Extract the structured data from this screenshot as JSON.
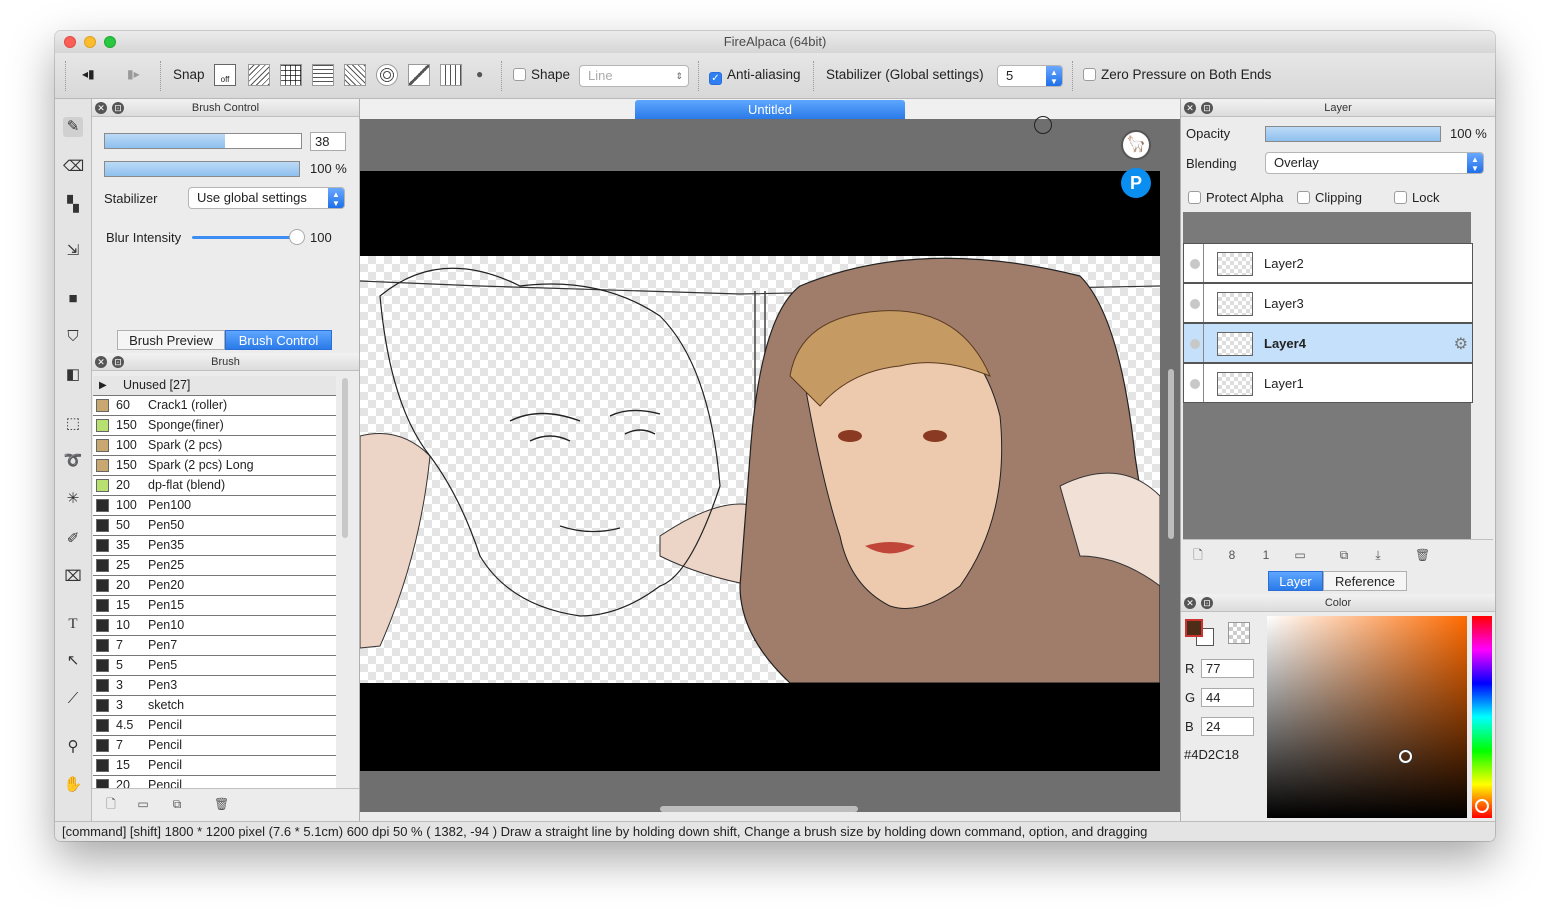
{
  "window": {
    "title": "FireAlpaca (64bit)"
  },
  "toolbar": {
    "snap_label": "Snap",
    "snap_off_label": "off",
    "shape_label": "Shape",
    "shape_value": "Line",
    "antialias_label": "Anti-aliasing",
    "stabilizer_label": "Stabilizer (Global settings)",
    "stabilizer_value": "5",
    "zero_pressure_label": "Zero Pressure on Both Ends"
  },
  "brush_control": {
    "title": "Brush Control",
    "size_value": "38",
    "size_fill": 0.61,
    "opacity_value": "100 %",
    "opacity_fill": 1.0,
    "stabilizer_label": "Stabilizer",
    "stabilizer_value": "Use global settings",
    "blur_label": "Blur Intensity",
    "blur_value": "100",
    "blur_fill": 1.0,
    "tabs": [
      "Brush Preview",
      "Brush Control"
    ]
  },
  "brush_panel": {
    "title": "Brush",
    "group_label": "Unused [27]",
    "items": [
      {
        "size": "60",
        "name": "Crack1 (roller)",
        "color": "#c8a870"
      },
      {
        "size": "150",
        "name": "Sponge(finer)",
        "color": "#b8e070"
      },
      {
        "size": "100",
        "name": "Spark (2 pcs)",
        "color": "#c8a870"
      },
      {
        "size": "150",
        "name": "Spark (2 pcs) Long",
        "color": "#c8a870"
      },
      {
        "size": "20",
        "name": "dp-flat (blend)",
        "color": "#b8e070"
      },
      {
        "size": "100",
        "name": "Pen100",
        "color": "#2a2a2a"
      },
      {
        "size": "50",
        "name": "Pen50",
        "color": "#2a2a2a"
      },
      {
        "size": "35",
        "name": "Pen35",
        "color": "#2a2a2a"
      },
      {
        "size": "25",
        "name": "Pen25",
        "color": "#2a2a2a"
      },
      {
        "size": "20",
        "name": "Pen20",
        "color": "#2a2a2a"
      },
      {
        "size": "15",
        "name": "Pen15",
        "color": "#2a2a2a"
      },
      {
        "size": "10",
        "name": "Pen10",
        "color": "#2a2a2a"
      },
      {
        "size": "7",
        "name": "Pen7",
        "color": "#2a2a2a"
      },
      {
        "size": "5",
        "name": "Pen5",
        "color": "#2a2a2a"
      },
      {
        "size": "3",
        "name": "Pen3",
        "color": "#2a2a2a"
      },
      {
        "size": "3",
        "name": "sketch",
        "color": "#2a2a2a"
      },
      {
        "size": "4.5",
        "name": "Pencil",
        "color": "#2a2a2a"
      },
      {
        "size": "7",
        "name": "Pencil",
        "color": "#2a2a2a"
      },
      {
        "size": "15",
        "name": "Pencil",
        "color": "#2a2a2a"
      },
      {
        "size": "20",
        "name": "Pencil",
        "color": "#2a2a2a"
      }
    ]
  },
  "canvas": {
    "tab_title": "Untitled"
  },
  "layer_panel": {
    "title": "Layer",
    "opacity_label": "Opacity",
    "opacity_value": "100 %",
    "opacity_fill": 1.0,
    "blending_label": "Blending",
    "blending_value": "Overlay",
    "protect_alpha_label": "Protect Alpha",
    "clipping_label": "Clipping",
    "lock_label": "Lock",
    "layers": [
      {
        "name": "Layer2",
        "selected": false
      },
      {
        "name": "Layer3",
        "selected": false
      },
      {
        "name": "Layer4",
        "selected": true
      },
      {
        "name": "Layer1",
        "selected": false
      }
    ],
    "tabs": [
      "Layer",
      "Reference"
    ]
  },
  "color_panel": {
    "title": "Color",
    "r_label": "R",
    "r_value": "77",
    "g_label": "G",
    "g_value": "44",
    "b_label": "B",
    "b_value": "24",
    "hex_value": "#4D2C18",
    "fg_color": "#4D2C18"
  },
  "status": {
    "text": "[command] [shift]     1800 * 1200 pixel     (7.6 * 5.1cm)     600 dpi     50 %     ( 1382, -94 )     Draw a straight line by holding down shift, Change a brush size by holding down command, option, and dragging"
  }
}
